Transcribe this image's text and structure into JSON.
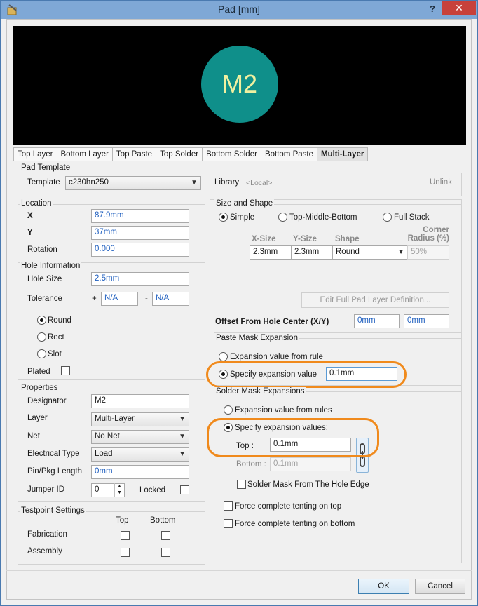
{
  "window": {
    "title": "Pad [mm]",
    "help": "?",
    "close": "✕"
  },
  "preview": {
    "designator": "M2"
  },
  "tabs": [
    "Top Layer",
    "Bottom Layer",
    "Top Paste",
    "Top Solder",
    "Bottom Solder",
    "Bottom Paste",
    "Multi-Layer"
  ],
  "pad_template": {
    "title": "Pad Template",
    "template_label": "Template",
    "template_value": "c230hn250",
    "library_label": "Library",
    "library_value": "<Local>",
    "unlink": "Unlink"
  },
  "location": {
    "title": "Location",
    "x_label": "X",
    "x_value": "87.9mm",
    "y_label": "Y",
    "y_value": "37mm",
    "rotation_label": "Rotation",
    "rotation_value": "0.000"
  },
  "hole": {
    "title": "Hole Information",
    "size_label": "Hole Size",
    "size_value": "2.5mm",
    "tolerance_label": "Tolerance",
    "plus": "+",
    "plus_value": "N/A",
    "minus": "-",
    "minus_value": "N/A",
    "round": "Round",
    "rect": "Rect",
    "slot": "Slot",
    "plated": "Plated"
  },
  "properties": {
    "title": "Properties",
    "designator_label": "Designator",
    "designator_value": "M2",
    "layer_label": "Layer",
    "layer_value": "Multi-Layer",
    "net_label": "Net",
    "net_value": "No Net",
    "etype_label": "Electrical Type",
    "etype_value": "Load",
    "pinpkg_label": "Pin/Pkg Length",
    "pinpkg_value": "0mm",
    "jumper_label": "Jumper ID",
    "jumper_value": "0",
    "locked_label": "Locked"
  },
  "testpoint": {
    "title": "Testpoint Settings",
    "top": "Top",
    "bottom": "Bottom",
    "fabrication": "Fabrication",
    "assembly": "Assembly"
  },
  "size_shape": {
    "title": "Size and Shape",
    "simple": "Simple",
    "tmb": "Top-Middle-Bottom",
    "full": "Full Stack",
    "xsize_h": "X-Size",
    "ysize_h": "Y-Size",
    "shape_h": "Shape",
    "corner_h": "Corner Radius (%)",
    "xsize": "2.3mm",
    "ysize": "2.3mm",
    "shape": "Round",
    "corner": "50%",
    "edit_btn": "Edit Full Pad Layer Definition...",
    "offset_label": "Offset From Hole Center (X/Y)",
    "offset_x": "0mm",
    "offset_y": "0mm"
  },
  "paste": {
    "title": "Paste Mask Expansion",
    "from_rule": "Expansion value from rule",
    "specify": "Specify expansion value",
    "value": "0.1mm"
  },
  "solder": {
    "title": "Solder Mask Expansions",
    "from_rules": "Expansion value from rules",
    "specify": "Specify expansion values:",
    "top_label": "Top :",
    "top_value": "0.1mm",
    "bottom_label": "Bottom :",
    "bottom_value": "0.1mm",
    "from_hole_edge": "Solder Mask From The Hole Edge",
    "tent_top": "Force complete tenting on top",
    "tent_bottom": "Force complete tenting on bottom"
  },
  "footer": {
    "ok": "OK",
    "cancel": "Cancel"
  },
  "colors": {
    "highlight": "#f08a1c",
    "pad": "#0f8f8a",
    "accent_text": "#1f5fbf"
  }
}
